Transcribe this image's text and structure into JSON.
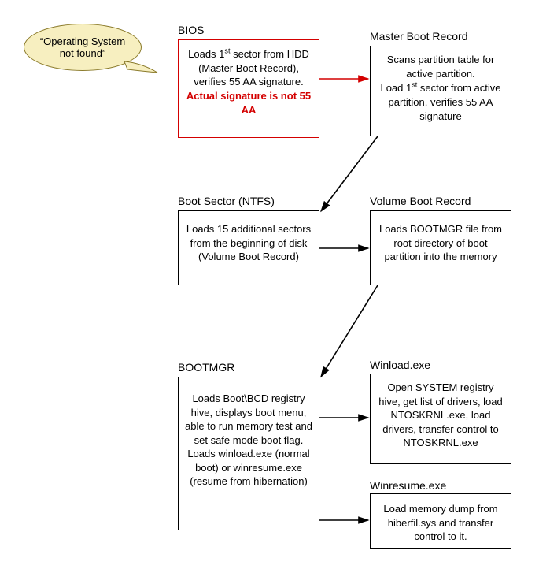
{
  "callout": {
    "text": "“Operating System not found”"
  },
  "bios": {
    "title": "BIOS",
    "text_a": "Loads 1",
    "text_a_sup": "st",
    "text_b": " sector from HDD (Master Boot Record), verifies 55 AA signature.",
    "error": "Actual signature is not 55 AA"
  },
  "mbr": {
    "title": "Master Boot Record",
    "text_a": "Scans partition table for active partition.",
    "text_b1": "Load 1",
    "text_b_sup": "st",
    "text_b2": " sector from active partition, verifies 55 AA signature"
  },
  "bs": {
    "title": "Boot Sector (NTFS)",
    "text": "Loads 15 additional sectors from the beginning of disk (Volume Boot Record)"
  },
  "vbr": {
    "title": "Volume Boot Record",
    "text": "Loads BOOTMGR file from root directory of boot partition into the memory"
  },
  "bootmgr": {
    "title": "BOOTMGR",
    "text": "Loads Boot\\BCD registry hive, displays boot menu, able to run memory test and set safe mode boot flag. Loads winload.exe (normal boot) or winresume.exe (resume from hibernation)"
  },
  "winload": {
    "title": "Winload.exe",
    "text": "Open SYSTEM registry hive, get list of drivers, load NTOSKRNL.exe, load drivers, transfer control to NTOSKRNL.exe"
  },
  "winresume": {
    "title": "Winresume.exe",
    "text": "Load memory dump from hiberfil.sys and transfer control to it."
  }
}
